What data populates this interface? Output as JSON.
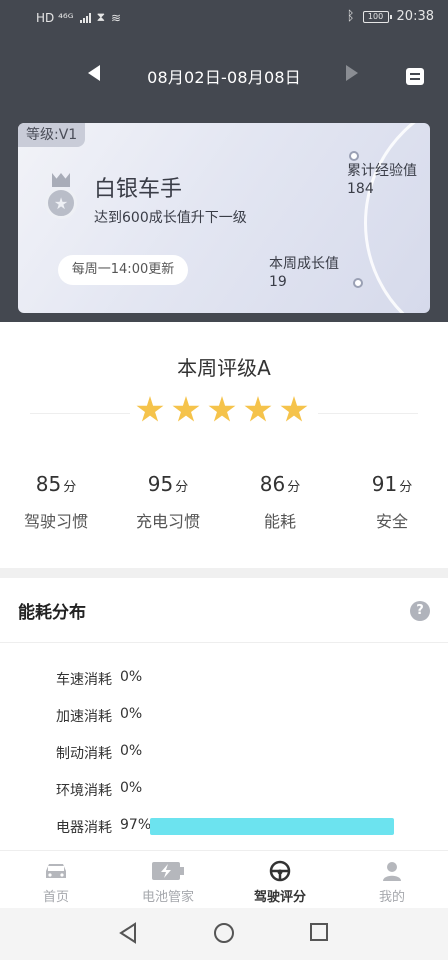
{
  "status_bar": {
    "left_text": "HD ⁴⁶ᴳ",
    "time": "20:38",
    "battery": "100"
  },
  "header": {
    "date_range": "08月02日-08月08日"
  },
  "level_card": {
    "level_tag": "等级:V1",
    "rank_title": "白银车手",
    "rank_subtitle": "达到600成长值升下一级",
    "update_note": "每周一14:00更新",
    "total_exp_label": "累计经验值",
    "total_exp_value": "184",
    "week_growth_label": "本周成长值",
    "week_growth_value": "19"
  },
  "rating": {
    "title": "本周评级A",
    "stars": 5,
    "star_color": "#f5c34b"
  },
  "scores": [
    {
      "value": "85",
      "unit": "分",
      "label": "驾驶习惯"
    },
    {
      "value": "95",
      "unit": "分",
      "label": "充电习惯"
    },
    {
      "value": "86",
      "unit": "分",
      "label": "能耗"
    },
    {
      "value": "91",
      "unit": "分",
      "label": "安全"
    }
  ],
  "energy": {
    "title": "能耗分布",
    "help_icon": "?",
    "bar_color": "#6ce3ef",
    "items": [
      {
        "label": "车速消耗",
        "percent_text": "0%",
        "percent": 0
      },
      {
        "label": "加速消耗",
        "percent_text": "0%",
        "percent": 0
      },
      {
        "label": "制动消耗",
        "percent_text": "0%",
        "percent": 0
      },
      {
        "label": "环境消耗",
        "percent_text": "0%",
        "percent": 0
      },
      {
        "label": "电器消耗",
        "percent_text": "97%",
        "percent": 97
      }
    ]
  },
  "tabs": [
    {
      "label": "首页",
      "icon": "car-icon",
      "active": false
    },
    {
      "label": "电池管家",
      "icon": "battery-charge-icon",
      "active": false
    },
    {
      "label": "驾驶评分",
      "icon": "steering-wheel-icon",
      "active": true
    },
    {
      "label": "我的",
      "icon": "person-icon",
      "active": false
    }
  ]
}
